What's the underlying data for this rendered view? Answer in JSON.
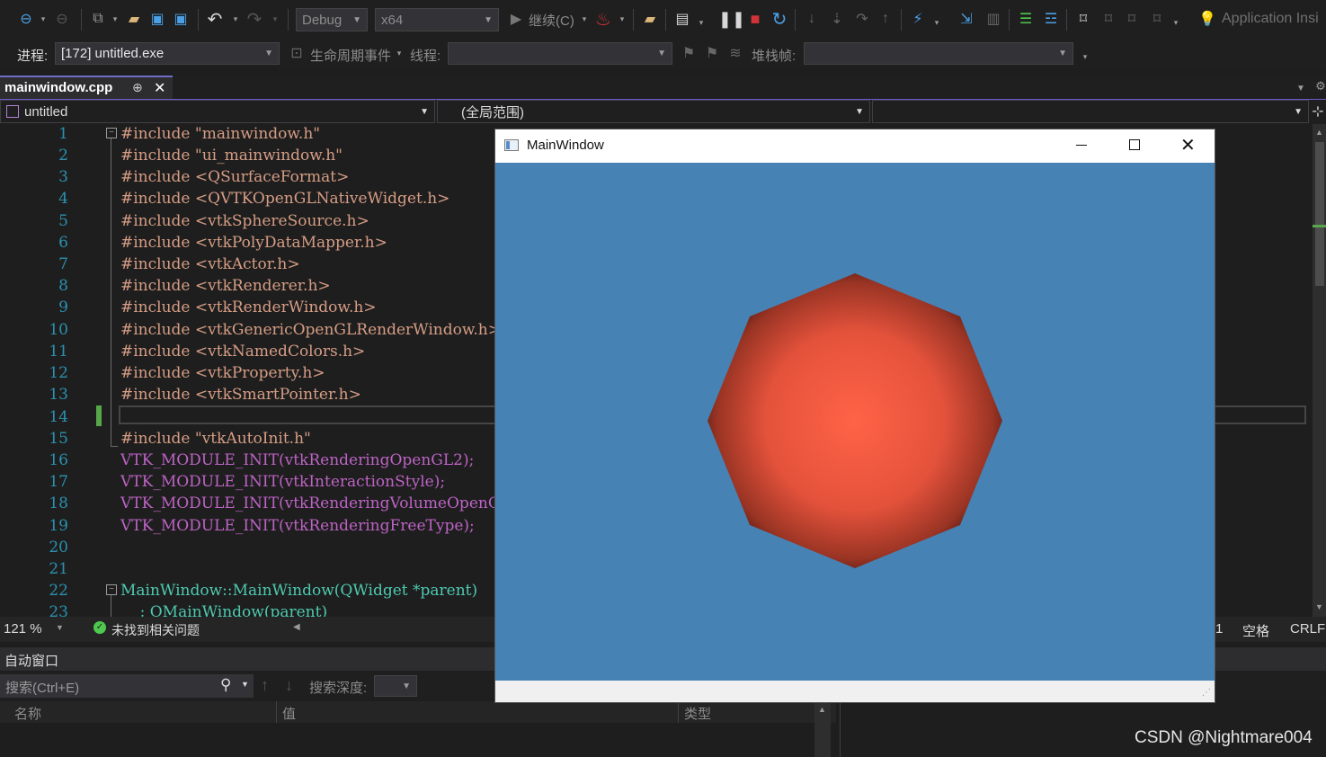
{
  "toolbar": {
    "config": "Debug",
    "platform": "x64",
    "continue_label": "继续(C)",
    "app_insights": "Application Insi"
  },
  "debugbar": {
    "process_label": "进程:",
    "process_value": "[172] untitled.exe",
    "lifecycle_label": "生命周期事件",
    "thread_label": "线程:",
    "stackframe_label": "堆栈帧:"
  },
  "tab": {
    "name": "mainwindow.cpp",
    "pin": "⊕",
    "close": "✕"
  },
  "navbar": {
    "project": "untitled",
    "scope": "(全局范围)"
  },
  "editor": {
    "line_numbers": [
      "1",
      "2",
      "3",
      "4",
      "5",
      "6",
      "7",
      "8",
      "9",
      "10",
      "11",
      "12",
      "13",
      "14",
      "15",
      "16",
      "17",
      "18",
      "19",
      "20",
      "21",
      "22",
      "23"
    ],
    "lines": [
      "#include \"mainwindow.h\"",
      "#include \"ui_mainwindow.h\"",
      "#include <QSurfaceFormat>",
      "#include <QVTKOpenGLNativeWidget.h>",
      "#include <vtkSphereSource.h>",
      "#include <vtkPolyDataMapper.h>",
      "#include <vtkActor.h>",
      "#include <vtkRenderer.h>",
      "#include <vtkRenderWindow.h>",
      "#include <vtkGenericOpenGLRenderWindow.h>",
      "#include <vtkNamedColors.h>",
      "#include <vtkProperty.h>",
      "#include <vtkSmartPointer.h>",
      "",
      "#include \"vtkAutoInit.h\"",
      "VTK_MODULE_INIT(vtkRenderingOpenGL2);",
      "VTK_MODULE_INIT(vtkInteractionStyle);",
      "VTK_MODULE_INIT(vtkRenderingVolumeOpenGL2)",
      "VTK_MODULE_INIT(vtkRenderingFreeType);",
      "",
      "",
      "MainWindow::MainWindow(QWidget *parent)",
      "    : QMainWindow(parent)"
    ]
  },
  "status": {
    "zoom": "121 %",
    "issues": "未找到相关问题",
    "col": "1",
    "spaces": "空格",
    "eol": "CRLF"
  },
  "autos": {
    "title": "自动窗口",
    "search_placeholder": "搜索(Ctrl+E)",
    "depth_label": "搜索深度:",
    "col_name": "名称",
    "col_value": "值",
    "col_type": "类型"
  },
  "mainwindow": {
    "title": "MainWindow",
    "bg_color": "#4682b4",
    "shape_color": "#ff6347"
  },
  "watermark": "CSDN @Nightmare004"
}
